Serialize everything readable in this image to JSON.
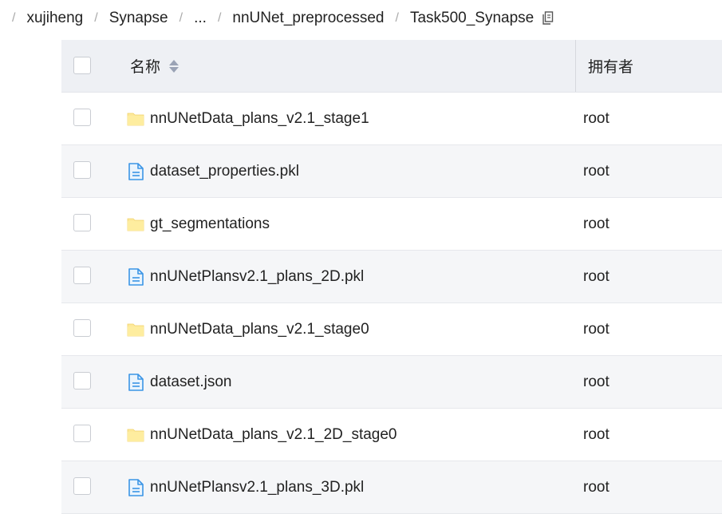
{
  "breadcrumb": {
    "items": [
      "xujiheng",
      "Synapse",
      "...",
      "nnUNet_preprocessed",
      "Task500_Synapse"
    ]
  },
  "table": {
    "headers": {
      "name": "名称",
      "owner": "拥有者"
    },
    "rows": [
      {
        "name": "nnUNetData_plans_v2.1_stage1",
        "type": "folder",
        "owner": "root"
      },
      {
        "name": "dataset_properties.pkl",
        "type": "file",
        "owner": "root"
      },
      {
        "name": "gt_segmentations",
        "type": "folder",
        "owner": "root"
      },
      {
        "name": "nnUNetPlansv2.1_plans_2D.pkl",
        "type": "file",
        "owner": "root"
      },
      {
        "name": "nnUNetData_plans_v2.1_stage0",
        "type": "folder",
        "owner": "root"
      },
      {
        "name": "dataset.json",
        "type": "file",
        "owner": "root"
      },
      {
        "name": "nnUNetData_plans_v2.1_2D_stage0",
        "type": "folder",
        "owner": "root"
      },
      {
        "name": "nnUNetPlansv2.1_plans_3D.pkl",
        "type": "file",
        "owner": "root"
      }
    ]
  },
  "colors": {
    "folder": "#fde99a",
    "file": "#3b95e6",
    "header_bg": "#eef0f4",
    "alt_row_bg": "#f5f6f8"
  }
}
